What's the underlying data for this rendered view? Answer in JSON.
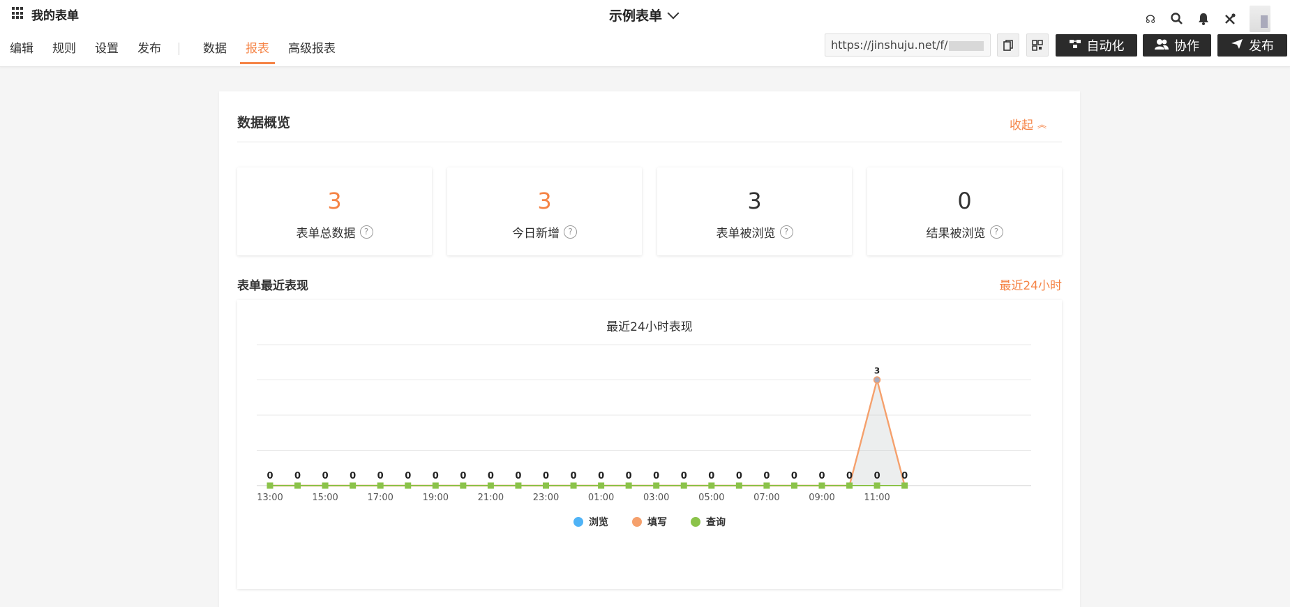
{
  "header": {
    "app_label": "我的表单",
    "form_title": "示例表单",
    "nav": [
      "编辑",
      "规则",
      "设置",
      "发布"
    ],
    "nav2": [
      "数据",
      "报表",
      "高级报表"
    ],
    "url": "https://jinshuju.net/f/",
    "buttons": {
      "automation": "自动化",
      "collab": "协作",
      "publish": "发布"
    }
  },
  "overview": {
    "title": "数据概览",
    "collapse": "收起",
    "stats": [
      {
        "value": "3",
        "label": "表单总数据"
      },
      {
        "value": "3",
        "label": "今日新增"
      },
      {
        "value": "3",
        "label": "表单被浏览"
      },
      {
        "value": "0",
        "label": "结果被浏览"
      }
    ]
  },
  "performance": {
    "title": "表单最近表现",
    "range_link": "最近24小时"
  },
  "colors": {
    "accent": "#f58345",
    "browse": "#4fb3f6",
    "fill": "#f5a06c",
    "query": "#8bc34a"
  },
  "chart_data": {
    "type": "line",
    "title": "最近24小时表现",
    "x": [
      "13:00",
      "14:00",
      "15:00",
      "16:00",
      "17:00",
      "18:00",
      "19:00",
      "20:00",
      "21:00",
      "22:00",
      "23:00",
      "00:00",
      "01:00",
      "02:00",
      "03:00",
      "04:00",
      "05:00",
      "06:00",
      "07:00",
      "08:00",
      "09:00",
      "10:00",
      "11:00",
      "12:00"
    ],
    "x_tick_labels": [
      "13:00",
      "15:00",
      "17:00",
      "19:00",
      "21:00",
      "23:00",
      "01:00",
      "03:00",
      "05:00",
      "07:00",
      "09:00",
      "11:00"
    ],
    "ylim": [
      0,
      4
    ],
    "grid": true,
    "legend_position": "bottom",
    "series": [
      {
        "name": "浏览",
        "values": [
          0,
          0,
          0,
          0,
          0,
          0,
          0,
          0,
          0,
          0,
          0,
          0,
          0,
          0,
          0,
          0,
          0,
          0,
          0,
          0,
          0,
          0,
          0,
          0
        ]
      },
      {
        "name": "填写",
        "values": [
          0,
          0,
          0,
          0,
          0,
          0,
          0,
          0,
          0,
          0,
          0,
          0,
          0,
          0,
          0,
          0,
          0,
          0,
          0,
          0,
          0,
          0,
          3,
          0
        ]
      },
      {
        "name": "查询",
        "values": [
          0,
          0,
          0,
          0,
          0,
          0,
          0,
          0,
          0,
          0,
          0,
          0,
          0,
          0,
          0,
          0,
          0,
          0,
          0,
          0,
          0,
          0,
          0,
          0
        ]
      }
    ]
  }
}
